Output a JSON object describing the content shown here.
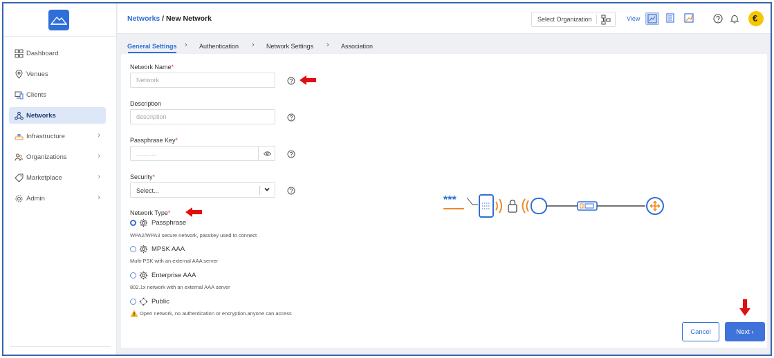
{
  "breadcrumb": {
    "parent": "Networks",
    "separator": " / ",
    "current": "New Network"
  },
  "header": {
    "org_select_label": "Select Organization",
    "view_label": "View"
  },
  "sidebar": {
    "items": [
      {
        "label": "Dashboard",
        "icon": "dashboard-icon",
        "chevron": false
      },
      {
        "label": "Venues",
        "icon": "location-pin-icon",
        "chevron": false
      },
      {
        "label": "Clients",
        "icon": "devices-icon",
        "chevron": false
      },
      {
        "label": "Networks",
        "icon": "network-icon",
        "chevron": false,
        "active": true
      },
      {
        "label": "Infrastructure",
        "icon": "router-icon",
        "chevron": true
      },
      {
        "label": "Organizations",
        "icon": "people-icon",
        "chevron": true
      },
      {
        "label": "Marketplace",
        "icon": "tag-icon",
        "chevron": true
      },
      {
        "label": "Admin",
        "icon": "gear-icon",
        "chevron": true
      }
    ]
  },
  "tabs": [
    {
      "label": "General Settings",
      "active": true
    },
    {
      "label": "Authentication"
    },
    {
      "label": "Network Settings"
    },
    {
      "label": "Association"
    }
  ],
  "form": {
    "network_name": {
      "label": "Network Name",
      "placeholder": "Network",
      "value": ""
    },
    "description": {
      "label": "Description",
      "placeholder": "description",
      "value": ""
    },
    "passphrase": {
      "label": "Passphrase Key",
      "placeholder": "............",
      "value": ""
    },
    "security": {
      "label": "Security",
      "value": "Select...",
      "dropdown_arrow": "✓"
    },
    "network_type": {
      "label": "Network Type",
      "options": [
        {
          "label": "Passphrase",
          "description": "WPA2/WPA3 secure network, passkey used to connect",
          "checked": true
        },
        {
          "label": "MPSK AAA",
          "description": "Multi-PSK with an external AAA server",
          "checked": false
        },
        {
          "label": "Enterprise AAA",
          "description": "802.1x network with an external AAA server",
          "checked": false
        },
        {
          "label": "Public",
          "description": "Open network, no authentication or encryption.anyone can access",
          "checked": false,
          "warning": true
        }
      ]
    },
    "required_marker": "*"
  },
  "illustration": {
    "password_mask": "***"
  },
  "actions": {
    "cancel_label": "Cancel",
    "next_label": "Next ›"
  },
  "colors": {
    "accent": "#2f6fd8",
    "required": "#e23c3c",
    "arrow": "#e01010",
    "illustration_orange": "#f08a24"
  }
}
